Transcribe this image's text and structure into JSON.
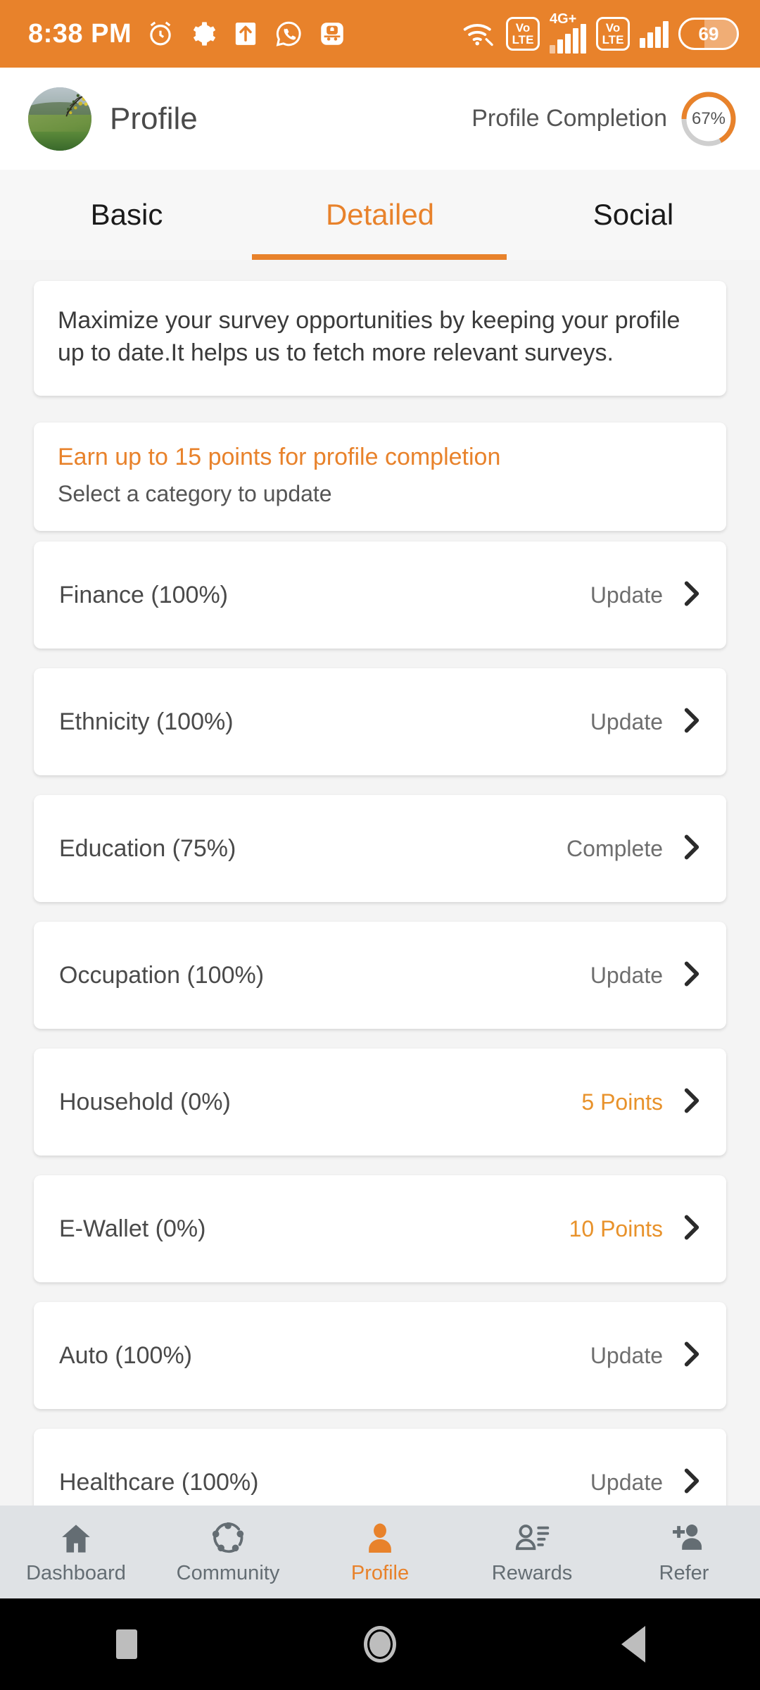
{
  "status_bar": {
    "time": "8:38 PM",
    "left_icons": [
      "alarm-clock-icon",
      "settings-gear-icon",
      "upload-arrow-icon",
      "whatsapp-icon",
      "app-notification-icon"
    ],
    "wifi": "wifi-icon",
    "sim1": {
      "volte_top": "Vo",
      "volte_bottom": "LTE",
      "network": "4G+"
    },
    "sim2": {
      "volte_top": "Vo",
      "volte_bottom": "LTE"
    },
    "battery_percent": "69",
    "background_color": "#E8822B"
  },
  "header": {
    "avatar": "user-avatar",
    "title": "Profile",
    "completion_label": "Profile Completion",
    "completion_percent": 67,
    "completion_text": "67%",
    "ring_color": "#E8822B",
    "ring_track_color": "#cfcfcf"
  },
  "tabs": {
    "items": [
      {
        "label": "Basic",
        "active": false
      },
      {
        "label": "Detailed",
        "active": true
      },
      {
        "label": "Social",
        "active": false
      }
    ],
    "active_color": "#E8822B"
  },
  "info_card": {
    "text": "Maximize your survey opportunities by keeping your profile up to date.It helps us to fetch more relevant surveys."
  },
  "earn_card": {
    "title": "Earn up to 15 points for profile completion",
    "subtitle": "Select a category to update",
    "title_color": "#E8822B"
  },
  "categories": [
    {
      "label": "Finance (100%)",
      "action": "Update",
      "is_points": false
    },
    {
      "label": "Ethnicity (100%)",
      "action": "Update",
      "is_points": false
    },
    {
      "label": "Education (75%)",
      "action": "Complete",
      "is_points": false
    },
    {
      "label": "Occupation (100%)",
      "action": "Update",
      "is_points": false
    },
    {
      "label": "Household (0%)",
      "action": "5 Points",
      "is_points": true
    },
    {
      "label": "E-Wallet (0%)",
      "action": "10 Points",
      "is_points": true
    },
    {
      "label": "Auto (100%)",
      "action": "Update",
      "is_points": false
    },
    {
      "label": "Healthcare (100%)",
      "action": "Update",
      "is_points": false
    }
  ],
  "bottom_nav": {
    "items": [
      {
        "label": "Dashboard",
        "icon": "home-icon",
        "active": false
      },
      {
        "label": "Community",
        "icon": "community-people-circle-icon",
        "active": false
      },
      {
        "label": "Profile",
        "icon": "person-icon",
        "active": true
      },
      {
        "label": "Rewards",
        "icon": "person-list-icon",
        "active": false
      },
      {
        "label": "Refer",
        "icon": "person-add-icon",
        "active": false
      }
    ],
    "active_color": "#E8822B",
    "inactive_color": "#646d73"
  },
  "android_nav": {
    "recents": "recents-square-icon",
    "home": "home-circle-icon",
    "back": "back-triangle-icon"
  }
}
